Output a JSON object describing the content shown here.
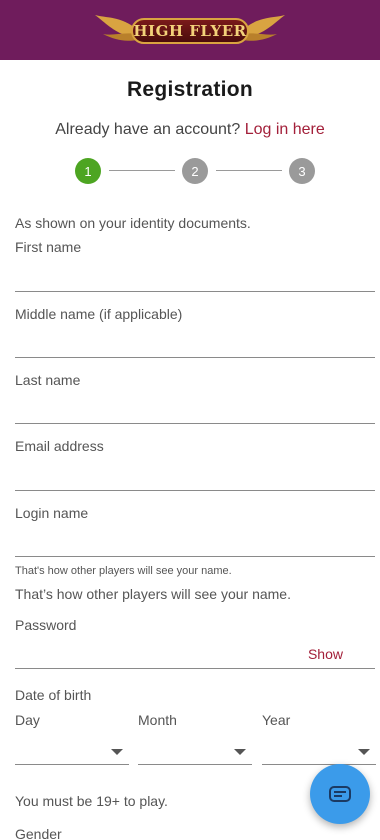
{
  "brand": {
    "logo_text": "HIGH FLYER",
    "header_color": "#6f1c5c"
  },
  "page": {
    "title": "Registration"
  },
  "login": {
    "prompt": "Already have an account?",
    "link": "Log in here"
  },
  "stepper": {
    "steps": [
      "1",
      "2",
      "3"
    ],
    "active_step": 1
  },
  "form": {
    "intro": "As shown on your identity documents.",
    "first_name_label": "First name",
    "middle_name_label": "Middle name (if applicable)",
    "last_name_label": "Last name",
    "email_label": "Email address",
    "login_name_label": "Login name",
    "login_name_helper": "That's how other players will see your name.",
    "login_name_note": "That’s how other players will see your name.",
    "password_label": "Password",
    "password_show": "Show",
    "dob_label": "Date of birth",
    "day_label": "Day",
    "month_label": "Month",
    "year_label": "Year",
    "age_note": "You must be 19+ to play.",
    "gender_label": "Gender"
  },
  "colors": {
    "accent_link": "#a3203a",
    "step_active": "#4da522",
    "step_inactive": "#9a9a9a",
    "chat": "#3b9bea"
  },
  "chat": {
    "icon": "chat-bubble-icon"
  }
}
